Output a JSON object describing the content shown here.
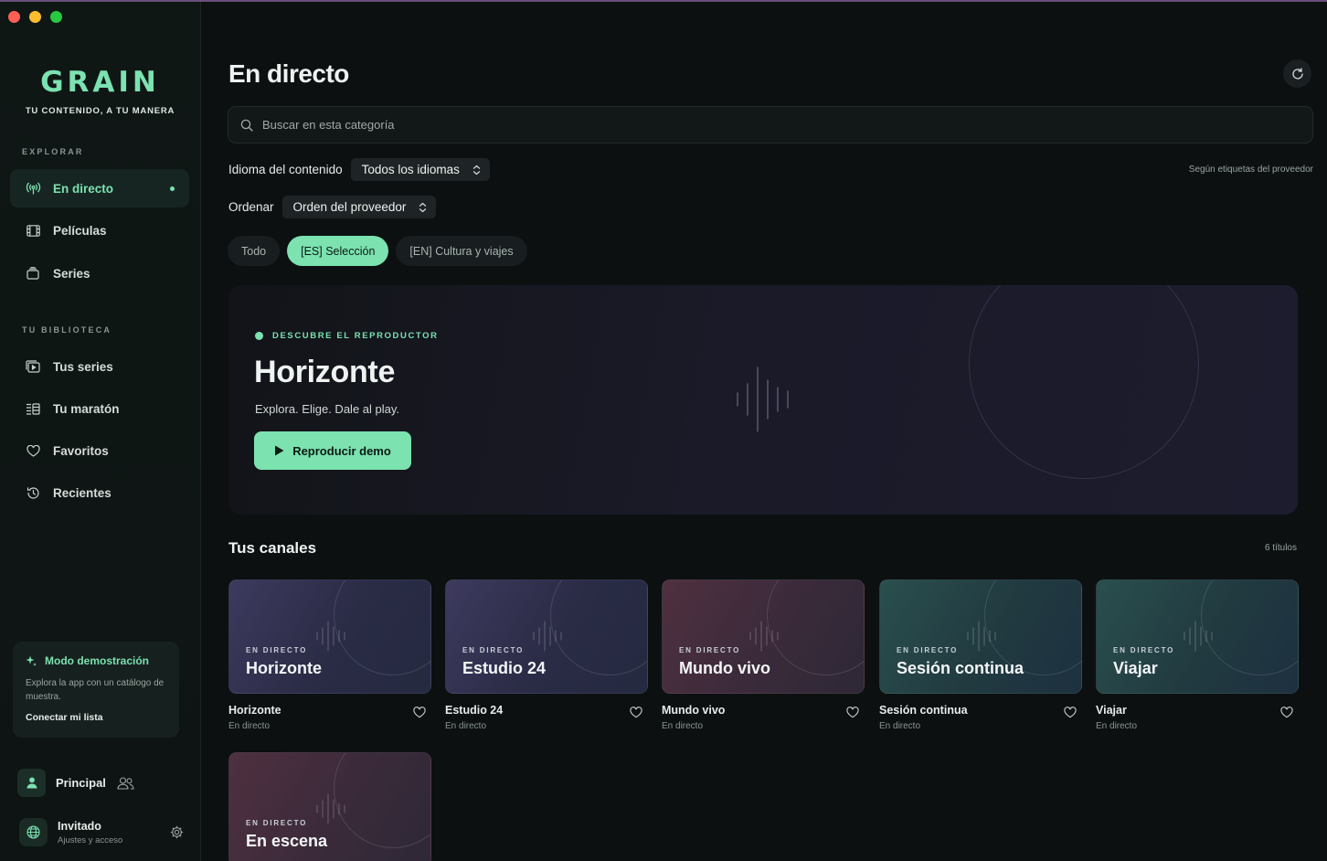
{
  "sidebar": {
    "brand_name": "GRAIN",
    "brand_tagline": "TU CONTENIDO, A TU MANERA",
    "explore_label": "EXPLORAR",
    "explore_items": [
      {
        "label": "En directo",
        "icon": "broadcast-icon",
        "active": true
      },
      {
        "label": "Películas",
        "icon": "film-icon"
      },
      {
        "label": "Series",
        "icon": "tv-stack-icon"
      }
    ],
    "library_label": "TU BIBLIOTECA",
    "library_items": [
      {
        "label": "Tus series",
        "icon": "my-series-icon"
      },
      {
        "label": "Tu maratón",
        "icon": "marathon-icon"
      },
      {
        "label": "Favoritos",
        "icon": "heart-icon"
      },
      {
        "label": "Recientes",
        "icon": "history-icon"
      }
    ],
    "demo": {
      "title": "Modo demostración",
      "description": "Explora la app con un catálogo de muestra.",
      "link": "Conectar mi lista"
    },
    "profile": {
      "name": "Principal"
    },
    "guest": {
      "name": "Invitado",
      "subtitle": "Ajustes y acceso"
    }
  },
  "main": {
    "title": "En directo",
    "search_placeholder": "Buscar en esta categoría",
    "language_label": "Idioma del contenido",
    "language_value": "Todos los idiomas",
    "sort_label": "Ordenar",
    "sort_value": "Orden del proveedor",
    "provider_note": "Según etiquetas del proveedor",
    "chips": [
      {
        "label": "Todo",
        "selected": false
      },
      {
        "label": "[ES] Selección",
        "selected": true
      },
      {
        "label": "[EN] Cultura y viajes",
        "selected": false
      }
    ],
    "hero": {
      "eyebrow": "DESCUBRE EL REPRODUCTOR",
      "title": "Horizonte",
      "subtitle": "Explora. Elige. Dale al play.",
      "button": "Reproducir demo"
    },
    "channels_title": "Tus canales",
    "channels_count": "6 títulos",
    "channels": [
      {
        "live_label": "EN DIRECTO",
        "name": "Horizonte",
        "title": "Horizonte",
        "subtitle": "En directo",
        "tone": "purple"
      },
      {
        "live_label": "EN DIRECTO",
        "name": "Estudio 24",
        "title": "Estudio 24",
        "subtitle": "En directo",
        "tone": "purple"
      },
      {
        "live_label": "EN DIRECTO",
        "name": "Mundo vivo",
        "title": "Mundo vivo",
        "subtitle": "En directo",
        "tone": "wine"
      },
      {
        "live_label": "EN DIRECTO",
        "name": "Sesión continua",
        "title": "Sesión continua",
        "subtitle": "En directo",
        "tone": "teal"
      },
      {
        "live_label": "EN DIRECTO",
        "name": "Viajar",
        "title": "Viajar",
        "subtitle": "En directo",
        "tone": "teal"
      },
      {
        "live_label": "EN DIRECTO",
        "name": "En escena",
        "title": "",
        "subtitle": "",
        "tone": "wine"
      }
    ]
  },
  "colors": {
    "accent": "#7be2b0",
    "background": "#0c1011",
    "sidebar": "#0f1715"
  }
}
